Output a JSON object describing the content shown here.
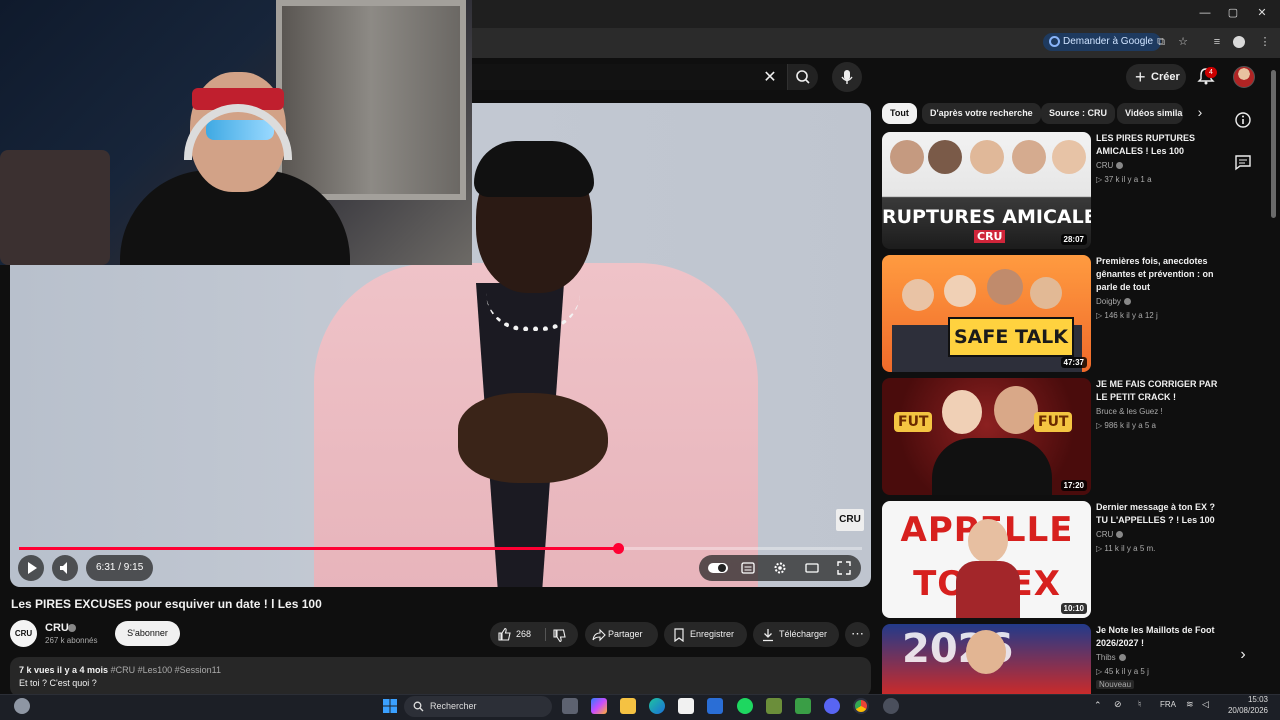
{
  "browser": {
    "google_button": "Demander à Google"
  },
  "header": {
    "create_label": "Créer",
    "notif_count": "4"
  },
  "player": {
    "time": "6:31 / 9:15",
    "progress": 0.7111,
    "watermark": "CRU"
  },
  "video": {
    "title": "Les PIRES EXCUSES pour esquiver un date ! l Les 100",
    "channel": "CRU",
    "channel_avatar": "CRU",
    "subscribers": "267 k abonnés",
    "subscribe_label": "S'abonner",
    "likes": "268",
    "share_label": "Partager",
    "save_label": "Enregistrer",
    "download_label": "Télécharger",
    "views_date": "7 k vues  il y a 4 mois",
    "hashtags": "#CRU #Les100 #Session11",
    "description_line": "Et toi ? C'est quoi ?"
  },
  "chips": [
    "Tout",
    "D'après votre recherche",
    "Source : CRU",
    "Vidéos simila"
  ],
  "recommendations": [
    {
      "title": "LES PIRES RUPTURES AMICALES ! Les 100",
      "channel": "CRU",
      "views": "37 k",
      "age": "il y a 1 a",
      "duration": "28:07",
      "thumb_text": "RUPTURES AMICALES",
      "thumb_sub": "CRU"
    },
    {
      "title": "Premières fois, anecdotes gênantes et prévention : on parle de tout",
      "channel": "Doigby",
      "views": "146 k",
      "age": "il y a 12 j",
      "duration": "47:37",
      "thumb_text": "SAFE TALK"
    },
    {
      "title": "JE ME FAIS CORRIGER PAR LE PETIT CRACK !",
      "channel": "Bruce & les Guez !",
      "views": "986 k",
      "age": "il y a 5 a",
      "duration": "17:20",
      "thumb_text": "FUT"
    },
    {
      "title": "Dernier message à ton EX ? TU L'APPELLES ? ! Les 100",
      "channel": "CRU",
      "views": "11 k",
      "age": "il y a 5 m.",
      "duration": "10:10",
      "thumb_text": "APPELLE TON EX"
    },
    {
      "title": "Je Note les Maillots de Foot 2026/2027 !",
      "channel": "Thibs",
      "views": "45 k",
      "age": "il y a 5 j",
      "badge": "Nouveau",
      "thumb_text": "2026"
    }
  ],
  "taskbar": {
    "search_label": "Rechercher",
    "lang": "FRA",
    "time": "15:03",
    "date": "20/08/2026"
  }
}
